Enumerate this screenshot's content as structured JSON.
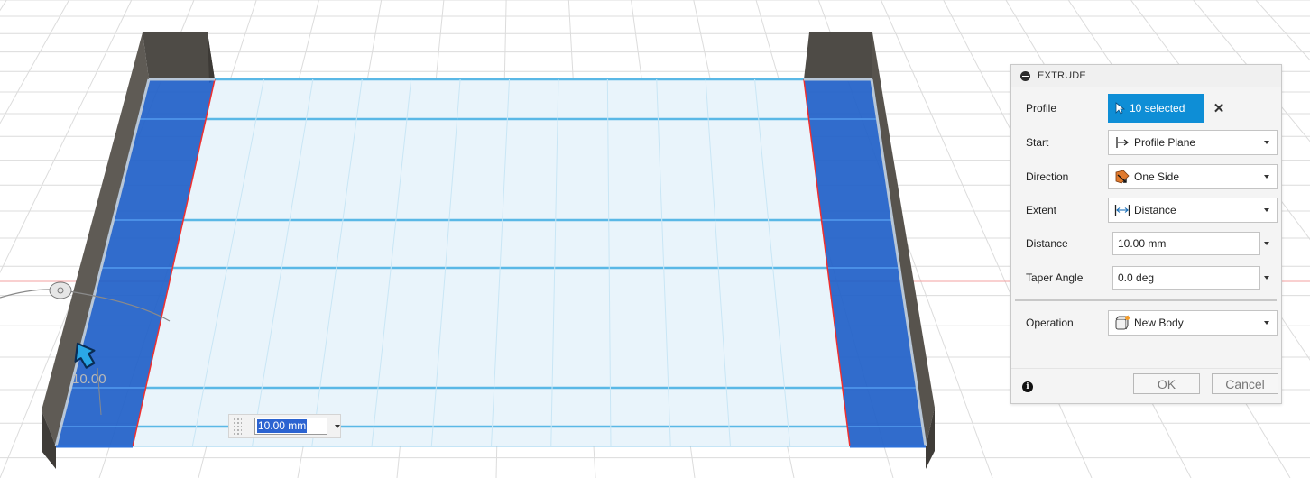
{
  "panel": {
    "title": "EXTRUDE",
    "rows": {
      "profile": {
        "label": "Profile",
        "value": "10 selected"
      },
      "start": {
        "label": "Start",
        "value": "Profile Plane",
        "icon": "profile-plane-icon"
      },
      "direction": {
        "label": "Direction",
        "value": "One Side",
        "icon": "one-side-icon"
      },
      "extent": {
        "label": "Extent",
        "value": "Distance",
        "icon": "distance-icon"
      },
      "distance": {
        "label": "Distance",
        "value": "10.00 mm"
      },
      "taper": {
        "label": "Taper Angle",
        "value": "0.0 deg"
      },
      "operation": {
        "label": "Operation",
        "value": "New Body",
        "icon": "new-body-icon"
      }
    },
    "ok_label": "OK",
    "cancel_label": "Cancel"
  },
  "canvas": {
    "distance_input": "10.00 mm",
    "dimension_label": "10.00"
  },
  "colors": {
    "accent": "#0e8ed6",
    "selected_face": "#1f5fc8",
    "wall": "#5e5a55",
    "sheet_line": "#5ab8e6",
    "axis_red": "#ef4040"
  }
}
